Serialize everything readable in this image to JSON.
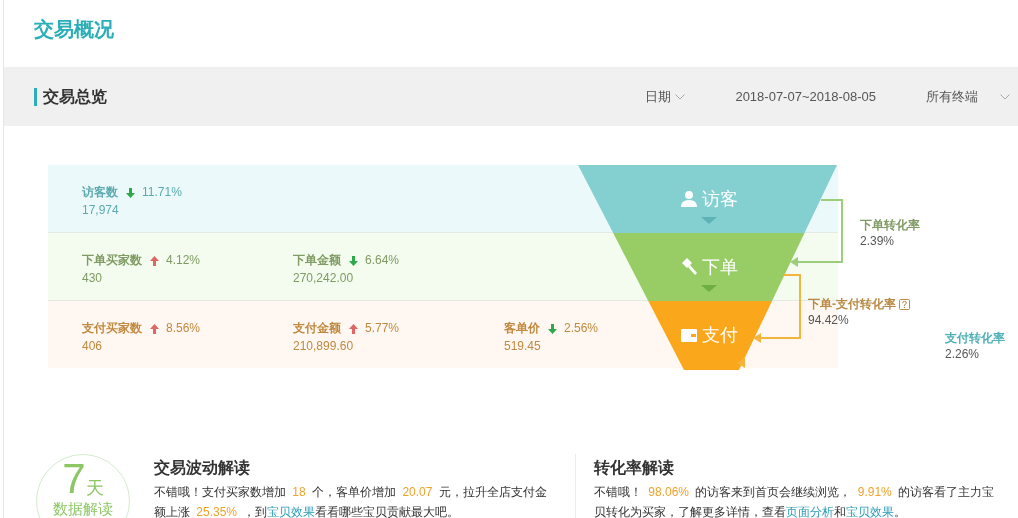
{
  "page_title": "交易概况",
  "section": {
    "title": "交易总览",
    "filters": [
      {
        "kind": "dropdown",
        "label": "日期"
      },
      {
        "kind": "text",
        "label": "2018-07-07~2018-08-05"
      },
      {
        "kind": "dropdown",
        "label": "所有终端"
      }
    ]
  },
  "funnel": {
    "rows": [
      {
        "kind": "visitor",
        "stage": "访客",
        "metrics": [
          {
            "label": "访客数",
            "increase": false,
            "change": "11.71%",
            "value": "17,974"
          }
        ]
      },
      {
        "kind": "order",
        "stage": "下单",
        "metrics": [
          {
            "label": "下单买家数",
            "increase": true,
            "change": "4.12%",
            "value": "430"
          },
          {
            "label": "下单金额",
            "increase": false,
            "change": "6.64%",
            "value": "270,242.00"
          }
        ]
      },
      {
        "kind": "payment",
        "stage": "支付",
        "metrics": [
          {
            "label": "支付买家数",
            "increase": true,
            "change": "8.56%",
            "value": "406"
          },
          {
            "label": "支付金额",
            "increase": true,
            "change": "5.77%",
            "value": "210,899.60"
          },
          {
            "label": "客单价",
            "increase": false,
            "change": "2.56%",
            "value": "519.45"
          }
        ]
      }
    ],
    "rates": [
      {
        "kind": "order",
        "label": "下单转化率",
        "value": "2.39%",
        "help": false
      },
      {
        "kind": "payment",
        "label": "下单-支付转化率",
        "value": "94.42%",
        "help": true
      },
      {
        "kind": "visitor",
        "label": "支付转化率",
        "value": "2.26%",
        "help": false
      }
    ]
  },
  "insights": {
    "badge": {
      "number": "7",
      "unit": "天",
      "caption": "数据解读"
    },
    "cards": [
      {
        "title": "交易波动解读",
        "segments": [
          {
            "kind": "plain",
            "text": "不错哦！支付买家数增加 "
          },
          {
            "kind": "highlight",
            "text": "18"
          },
          {
            "kind": "plain",
            "text": " 个，客单价增加 "
          },
          {
            "kind": "highlight",
            "text": "20.07"
          },
          {
            "kind": "plain",
            "text": " 元，拉升全店支付金额上涨 "
          },
          {
            "kind": "highlight",
            "text": "25.35%"
          },
          {
            "kind": "plain",
            "text": " ，到"
          },
          {
            "kind": "link",
            "text": "宝贝效果"
          },
          {
            "kind": "plain",
            "text": "看看哪些宝贝贡献最大吧。"
          }
        ]
      },
      {
        "title": "转化率解读",
        "segments": [
          {
            "kind": "plain",
            "text": "不错哦！ "
          },
          {
            "kind": "highlight",
            "text": "98.06%"
          },
          {
            "kind": "plain",
            "text": " 的访客来到首页会继续浏览， "
          },
          {
            "kind": "highlight",
            "text": "9.91%"
          },
          {
            "kind": "plain",
            "text": " 的访客看了主力宝贝转化为买家，了解更多详情，查看"
          },
          {
            "kind": "link",
            "text": "页面分析"
          },
          {
            "kind": "plain",
            "text": "和"
          },
          {
            "kind": "link",
            "text": "宝贝效果"
          },
          {
            "kind": "plain",
            "text": "。"
          }
        ]
      }
    ]
  }
}
